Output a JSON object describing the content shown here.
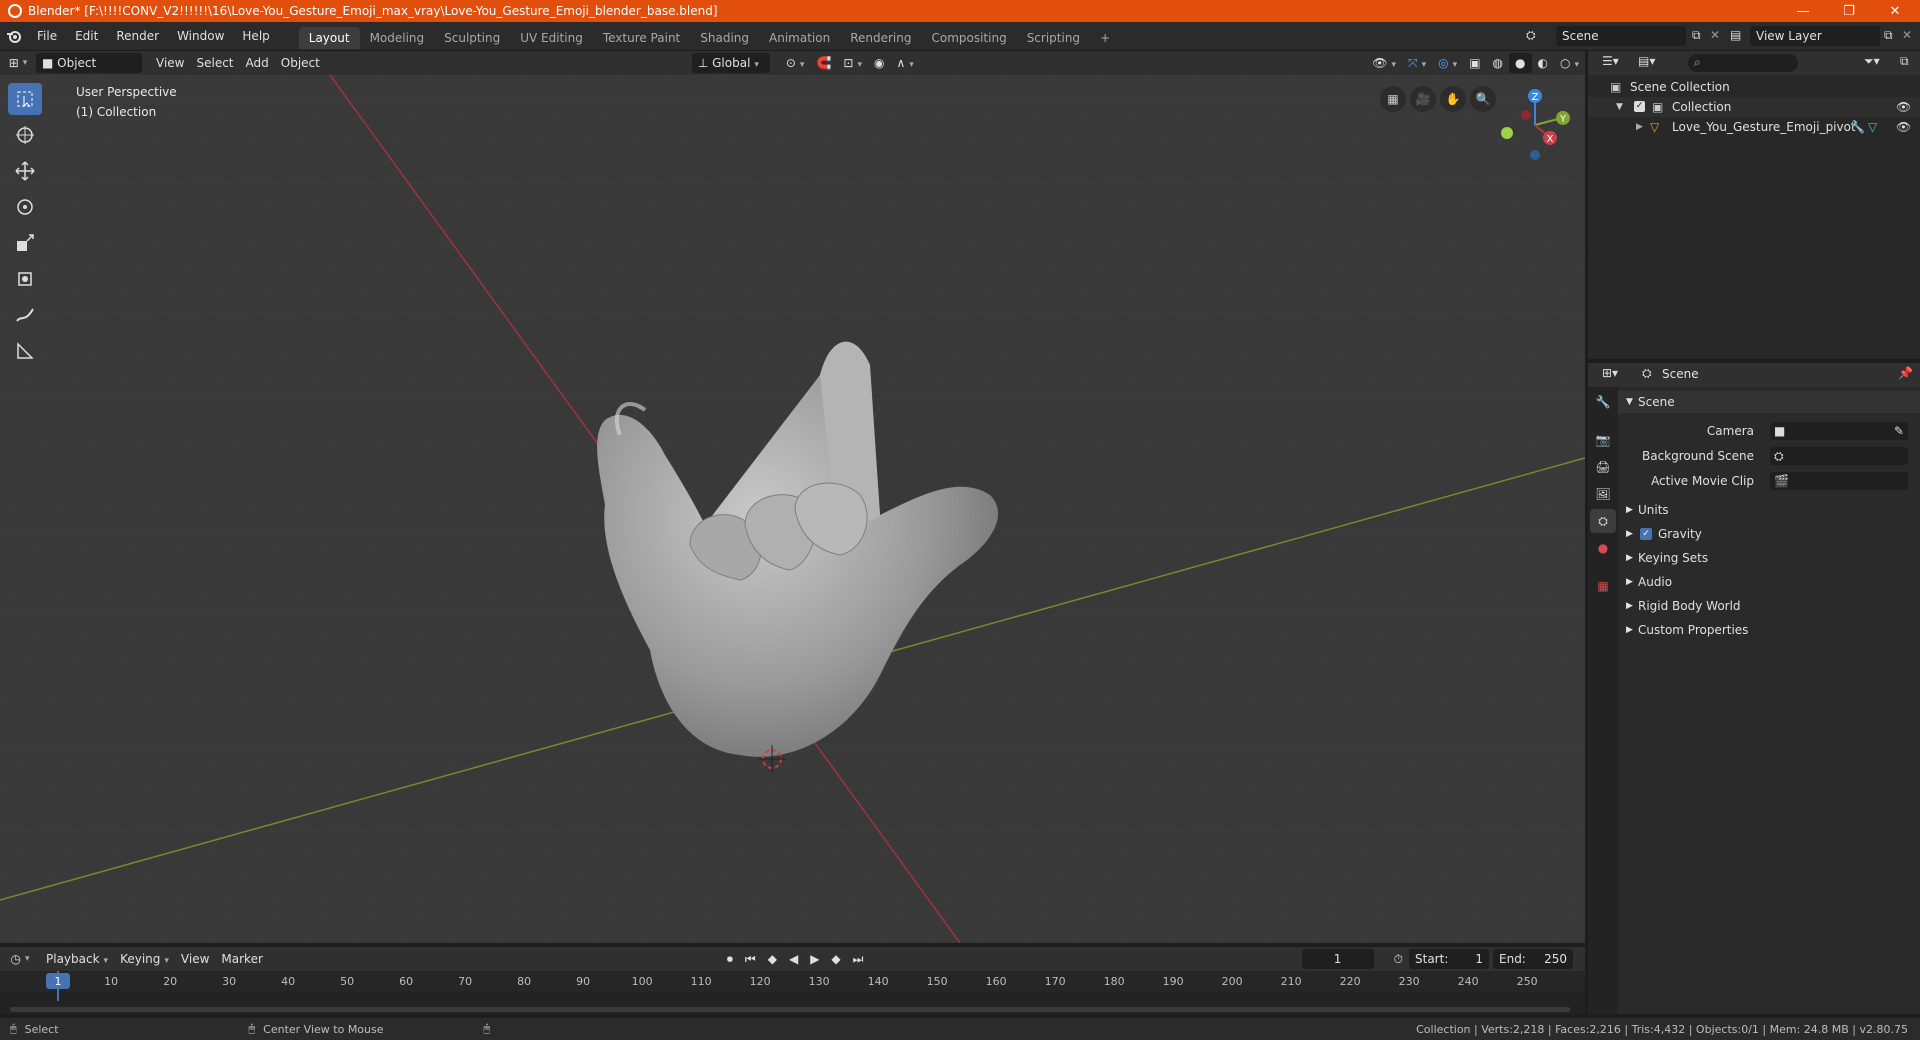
{
  "window": {
    "title": "Blender* [F:\\!!!!CONV_V2!!!!!!\\16\\Love-You_Gesture_Emoji_max_vray\\Love-You_Gesture_Emoji_blender_base.blend]",
    "minimize": "—",
    "maximize": "❐",
    "close": "✕"
  },
  "menu": [
    "File",
    "Edit",
    "Render",
    "Window",
    "Help"
  ],
  "workspaces": [
    "Layout",
    "Modeling",
    "Sculpting",
    "UV Editing",
    "Texture Paint",
    "Shading",
    "Animation",
    "Rendering",
    "Compositing",
    "Scripting"
  ],
  "active_workspace": "Layout",
  "add_workspace": "+",
  "scene_name": "Scene",
  "view_layer": "View Layer",
  "viewport_header": {
    "mode": "Object Mode",
    "menus": [
      "View",
      "Select",
      "Add",
      "Object"
    ],
    "orientation": "Global"
  },
  "viewport": {
    "perspective": "User Perspective",
    "collection": "(1) Collection",
    "gizmo": {
      "z": "Z",
      "y": "Y",
      "x": "X"
    }
  },
  "outliner": {
    "scene_collection": "Scene Collection",
    "collection": "Collection",
    "object": "Love_You_Gesture_Emoji_pivot"
  },
  "properties": {
    "breadcrumb": "Scene",
    "panel_title": "Scene",
    "fields": [
      {
        "label": "Camera"
      },
      {
        "label": "Background Scene"
      },
      {
        "label": "Active Movie Clip"
      }
    ],
    "subpanels": [
      "Units",
      "Gravity",
      "Keying Sets",
      "Audio",
      "Rigid Body World",
      "Custom Properties"
    ]
  },
  "timeline": {
    "menus": [
      "Playback",
      "Keying",
      "View",
      "Marker"
    ],
    "current_frame": "1",
    "start_label": "Start:",
    "start": "1",
    "end_label": "End:",
    "end": "250",
    "ticks": [
      "10",
      "20",
      "30",
      "40",
      "50",
      "60",
      "70",
      "80",
      "90",
      "100",
      "110",
      "120",
      "130",
      "140",
      "150",
      "160",
      "170",
      "180",
      "190",
      "200",
      "210",
      "220",
      "230",
      "240",
      "250"
    ],
    "playhead": "1"
  },
  "statusbar": {
    "select": "Select",
    "center_view": "Center View to Mouse",
    "stats": "Collection | Verts:2,218 | Faces:2,216 | Tris:4,432 | Objects:0/1 | Mem: 24.8 MB | v2.80.75"
  },
  "colors": {
    "titlebar": "#e24e0c",
    "accent": "#4772b3",
    "x_axis": "#b3363f",
    "y_axis": "#7fa533",
    "z_axis": "#3c86d6"
  }
}
